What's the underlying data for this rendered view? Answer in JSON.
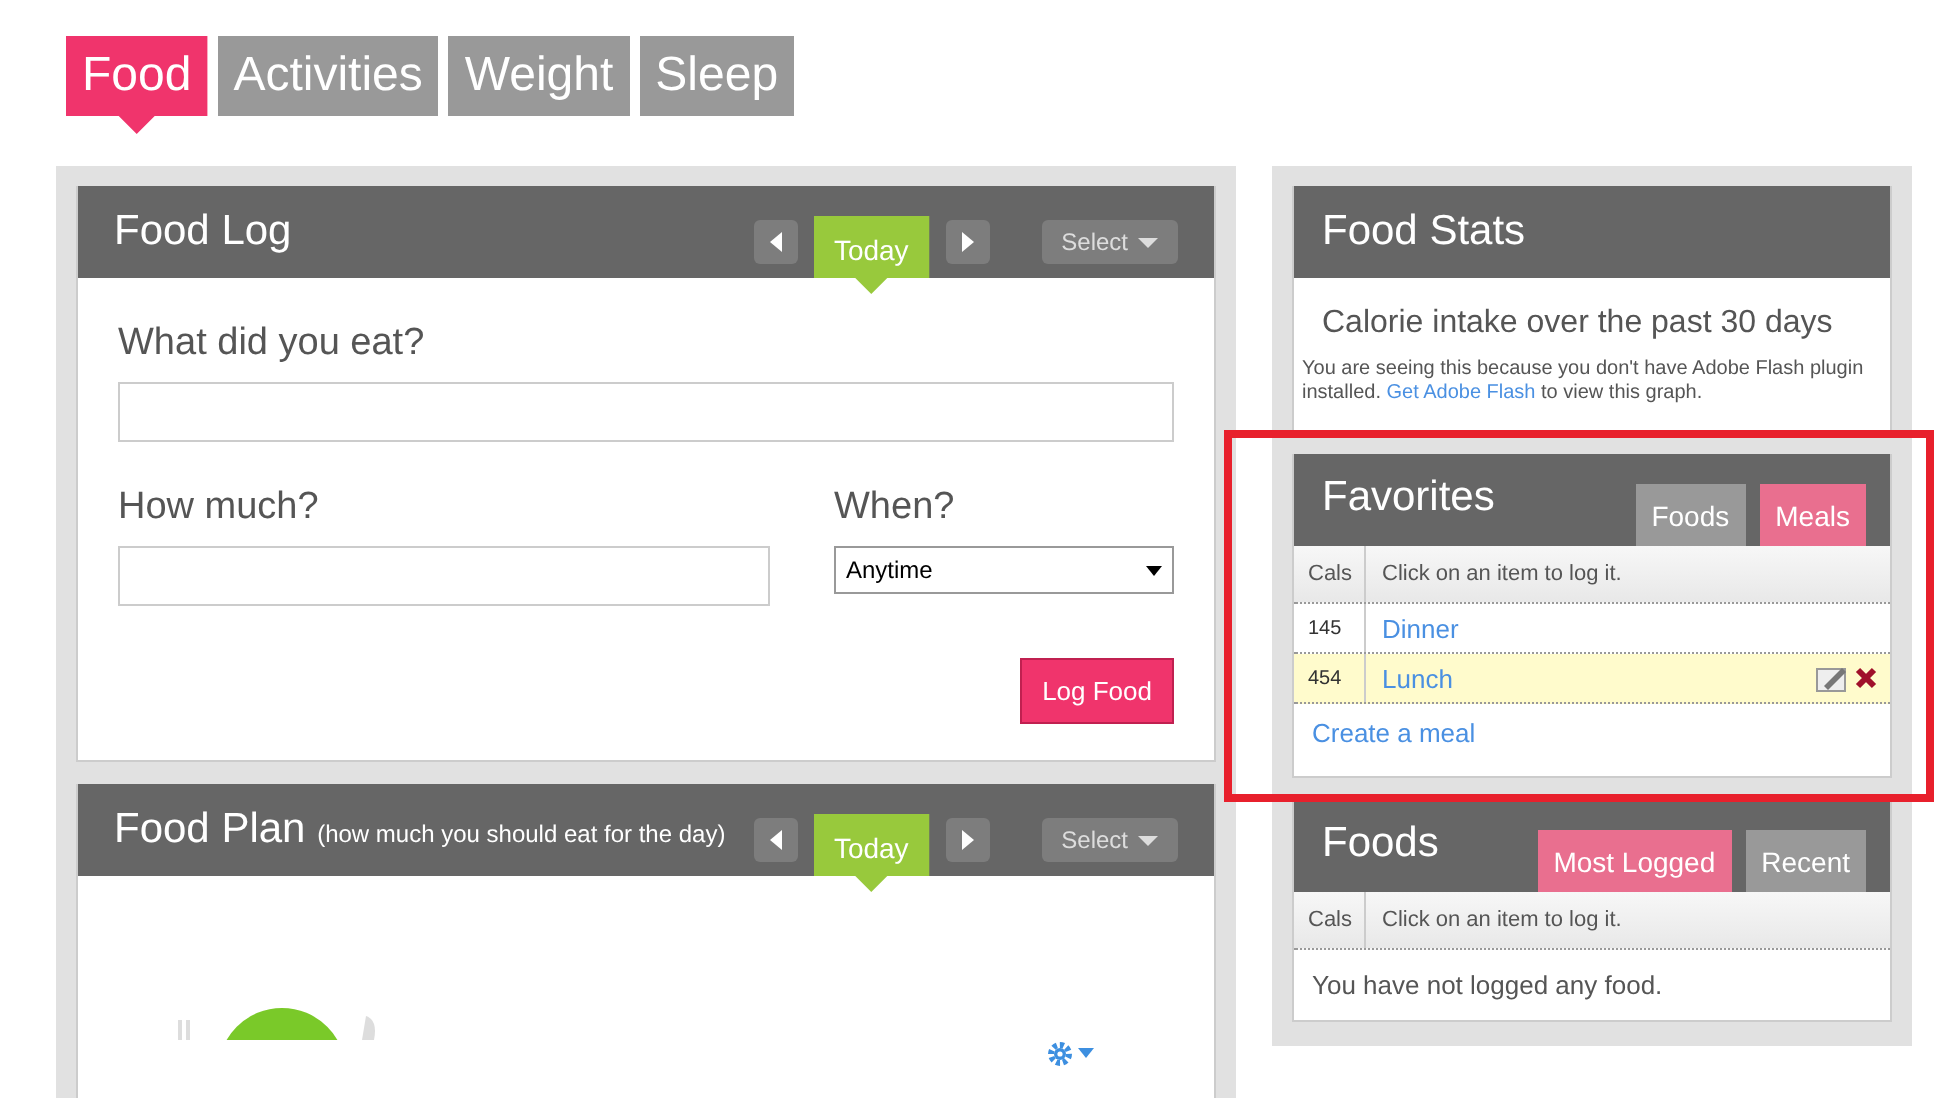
{
  "nav_tabs": [
    {
      "label": "Food",
      "selected": true
    },
    {
      "label": "Activities",
      "selected": false
    },
    {
      "label": "Weight",
      "selected": false
    },
    {
      "label": "Sleep",
      "selected": false
    }
  ],
  "food_log": {
    "title": "Food Log",
    "date": "Today",
    "select": "Select",
    "what_label": "What did you eat?",
    "how_much_label": "How much?",
    "when_label": "When?",
    "when_value": "Anytime",
    "log_button": "Log Food"
  },
  "food_plan": {
    "title": "Food Plan",
    "subtitle": "(how much you should eat for the day)",
    "date": "Today",
    "select": "Select"
  },
  "food_stats": {
    "title": "Food Stats",
    "chart_title": "Calorie intake over the past 30 days",
    "notice_before": "You are seeing this because you don't have Adobe Flash plugin installed. ",
    "notice_link": "Get Adobe Flash",
    "notice_after": " to view this graph."
  },
  "favorites": {
    "title": "Favorites",
    "tabs": [
      {
        "label": "Foods",
        "selected": false
      },
      {
        "label": "Meals",
        "selected": true
      }
    ],
    "columns": [
      "Cals",
      "Click on an item to log it."
    ],
    "rows": [
      {
        "cals": "145",
        "name": "Dinner",
        "highlighted": false
      },
      {
        "cals": "454",
        "name": "Lunch",
        "highlighted": true
      }
    ],
    "create_link": "Create a meal"
  },
  "foods": {
    "title": "Foods",
    "tabs": [
      {
        "label": "Most Logged",
        "selected": true
      },
      {
        "label": "Recent",
        "selected": false
      }
    ],
    "columns": [
      "Cals",
      "Click on an item to log it."
    ],
    "empty_message": "You have not logged any food."
  }
}
